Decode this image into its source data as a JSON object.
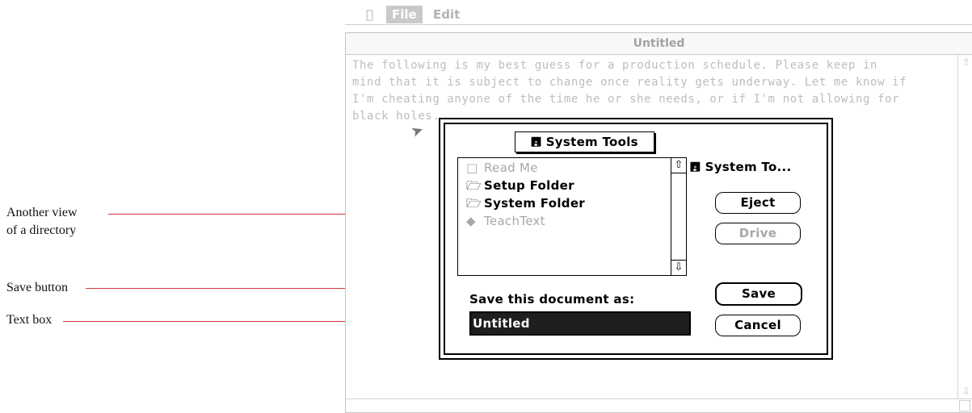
{
  "menubar": {
    "apple": "",
    "file": "File",
    "edit": "Edit"
  },
  "window": {
    "title": "Untitled",
    "body_lines": [
      "The following is my best guess for a production schedule.  Please keep in",
      "mind that it is subject to change once reality gets underway.  Let me know if",
      "I'm cheating anyone of the time he or she needs, or if I'm not allowing for",
      "black holes."
    ]
  },
  "dialog": {
    "folder_popup": "System Tools",
    "files": [
      {
        "name": "Read Me",
        "icon": "document-icon",
        "enabled": false
      },
      {
        "name": "Setup Folder",
        "icon": "folder-icon",
        "enabled": true
      },
      {
        "name": "System Folder",
        "icon": "folder-icon",
        "enabled": true
      },
      {
        "name": "TeachText",
        "icon": "application-icon",
        "enabled": false
      }
    ],
    "volume": "System To...",
    "eject": "Eject",
    "drive": "Drive",
    "prompt": "Save this document as:",
    "filename": "Untitled",
    "save": "Save",
    "cancel": "Cancel"
  },
  "callouts": {
    "directory": [
      "Another view",
      "of a directory"
    ],
    "save_button": "Save button",
    "text_box": "Text box"
  },
  "colors": {
    "callout_line": "#d3343a",
    "dimmed_text": "#bdbdbd"
  }
}
